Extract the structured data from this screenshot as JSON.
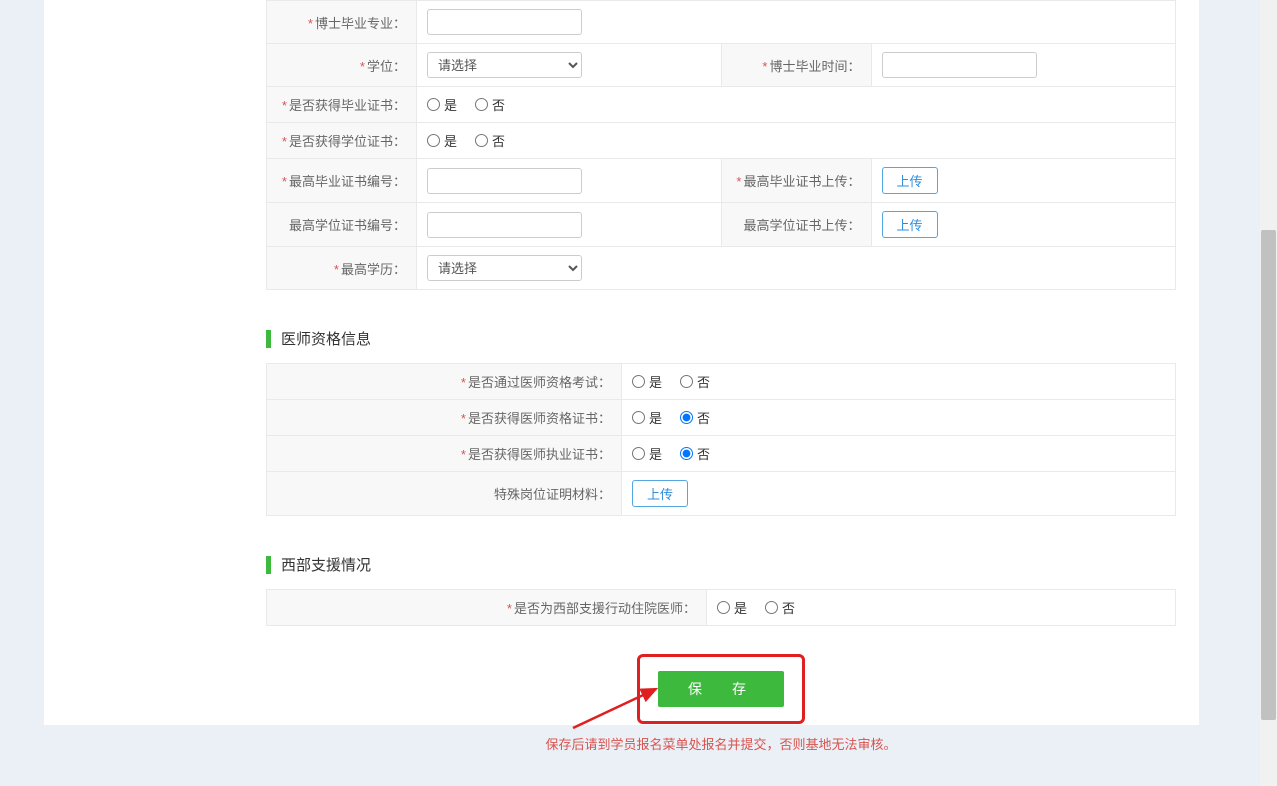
{
  "labels": {
    "phd_major": "博士毕业专业：",
    "degree": "学位：",
    "phd_grad_time": "博士毕业时间：",
    "has_grad_cert": "是否获得毕业证书：",
    "has_degree_cert": "是否获得学位证书：",
    "top_grad_cert_no": "最高毕业证书编号：",
    "top_grad_cert_upload": "最高毕业证书上传：",
    "top_degree_cert_no": "最高学位证书编号：",
    "top_degree_cert_upload": "最高学位证书上传：",
    "top_education": "最高学历：",
    "pass_exam": "是否通过医师资格考试：",
    "has_qual_cert": "是否获得医师资格证书：",
    "has_practice_cert": "是否获得医师执业证书：",
    "special_post": "特殊岗位证明材料：",
    "is_west_support": "是否为西部支援行动住院医师："
  },
  "sections": {
    "physician": "医师资格信息",
    "west": "西部支援情况"
  },
  "options": {
    "select_placeholder": "请选择",
    "yes": "是",
    "no": "否"
  },
  "buttons": {
    "upload": "上传",
    "save": "保　存"
  },
  "note": "保存后请到学员报名菜单处报名并提交，否则基地无法审核。"
}
